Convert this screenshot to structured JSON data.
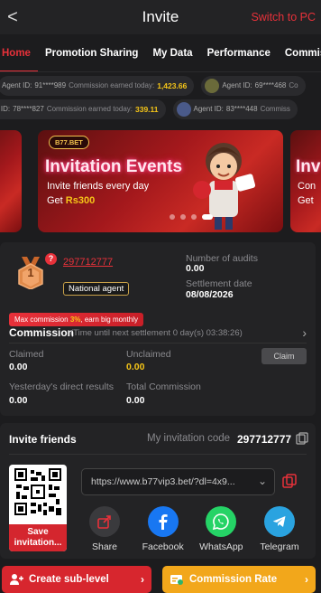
{
  "header": {
    "back": "<",
    "title": "Invite",
    "switch_pc": "Switch to PC"
  },
  "tabs": [
    "Home",
    "Promotion Sharing",
    "My Data",
    "Performance",
    "Commission"
  ],
  "ticker": {
    "row1": [
      {
        "label": "Agent ID:",
        "id": "91****989",
        "text": "Commission earned today:",
        "value": "1,423.66"
      },
      {
        "label": "Agent ID:",
        "id": "69****468",
        "text": "Co",
        "value": ""
      }
    ],
    "row2": [
      {
        "label": "nt ID:",
        "id": "78****827",
        "text": "Commission earned today:",
        "value": "339.11"
      },
      {
        "label": "Agent ID:",
        "id": "83****448",
        "text": "Commiss",
        "value": ""
      }
    ]
  },
  "banner": {
    "brand": "B77.BET",
    "title": "Invitation Events",
    "line1": "Invite friends every day",
    "line2_prefix": "Get",
    "line2_amount": "Rs300",
    "right_peek_title": "Inv",
    "right_peek_line1": "Con",
    "right_peek_line2": "Get"
  },
  "agent": {
    "rank": "1",
    "question": "?",
    "uid": "297712777",
    "type": "National agent",
    "audits_label": "Number of audits",
    "audits_value": "0.00",
    "settle_label": "Settlement date",
    "settle_value": "08/08/2026"
  },
  "commission": {
    "max_prefix": "Max commission",
    "max_value": "3%",
    "max_suffix": ", earn big monthly",
    "title": "Commission",
    "subtitle": "(Time until next settlement 0 day(s) 03:38:26)",
    "claimed_label": "Claimed",
    "claimed_value": "0.00",
    "unclaimed_label": "Unclaimed",
    "unclaimed_value": "0.00",
    "claim_btn": "Claim",
    "yesterday_label": "Yesterday's direct results",
    "yesterday_value": "0.00",
    "total_label": "Total Commission",
    "total_value": "0.00"
  },
  "invite": {
    "title": "Invite friends",
    "code_label": "My invitation code",
    "code": "297712777",
    "link": "https://www.b77vip3.bet/?dl=4x9...",
    "save_label": "Save invitation...",
    "shares": [
      "Share",
      "Facebook",
      "WhatsApp",
      "Telegram"
    ]
  },
  "bottom": {
    "create": "Create sub-level",
    "rate": "Commission Rate"
  },
  "colors": {
    "accent": "#e8313a",
    "gold": "#f5c518",
    "background": "#1c1c1e",
    "panel": "#232325"
  }
}
